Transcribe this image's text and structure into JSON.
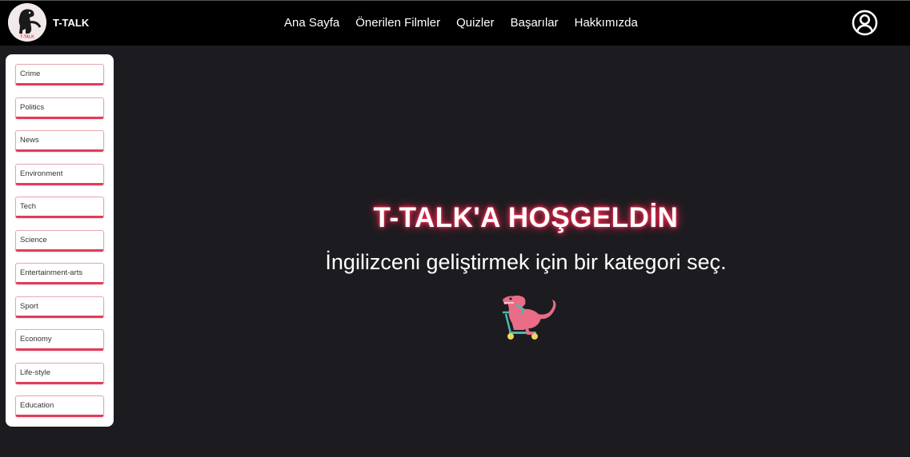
{
  "header": {
    "brand_name": "T-TALK",
    "logo_caption": "T-TALK",
    "nav": [
      "Ana Sayfa",
      "Önerilen Filmler",
      "Quizler",
      "Başarılar",
      "Hakkımızda"
    ],
    "profile_icon": "user-circle-icon"
  },
  "sidebar": {
    "categories": [
      "Crime",
      "Politics",
      "News",
      "Environment",
      "Tech",
      "Science",
      "Entertainment-arts",
      "Sport",
      "Economy",
      "Life-style",
      "Education"
    ]
  },
  "hero": {
    "title": "T-TALK'A HOŞGELDİN",
    "subtitle": "İngilizceni geliştirmek için bir kategori seç.",
    "mascot": "dinosaur-on-scooter"
  },
  "colors": {
    "navbar_bg": "#000000",
    "page_bg": "#1c1c20",
    "accent": "#e33b5c",
    "sidebar_bg": "#ffffff"
  }
}
